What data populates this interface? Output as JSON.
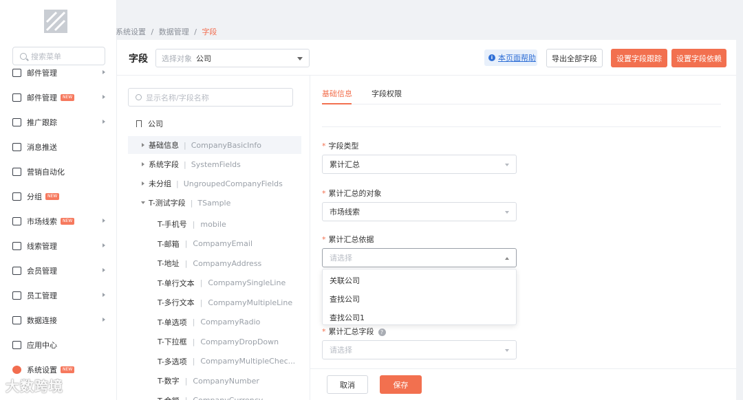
{
  "breadcrumb": [
    "系统设置",
    "/",
    "数据管理",
    "/",
    "字段"
  ],
  "sidebar": {
    "search_placeholder": "搜索菜单",
    "items": [
      {
        "label": "邮件管理",
        "icon": "mail-icon",
        "new": false,
        "arrow": true
      },
      {
        "label": "邮件管理",
        "icon": "mail-icon",
        "new": true,
        "arrow": true
      },
      {
        "label": "推广跟踪",
        "icon": "target-icon",
        "new": false,
        "arrow": true
      },
      {
        "label": "消息推送",
        "icon": "send-icon",
        "new": false,
        "arrow": false
      },
      {
        "label": "营销自动化",
        "icon": "automation-icon",
        "new": false,
        "arrow": false
      },
      {
        "label": "分组",
        "icon": "group-icon",
        "new": true,
        "arrow": false
      },
      {
        "label": "市场线索",
        "icon": "leads-icon",
        "new": true,
        "arrow": true
      },
      {
        "label": "线索管理",
        "icon": "clue-icon",
        "new": false,
        "arrow": true
      },
      {
        "label": "会员管理",
        "icon": "diamond-icon",
        "new": false,
        "arrow": true
      },
      {
        "label": "员工管理",
        "icon": "staff-icon",
        "new": false,
        "arrow": true
      },
      {
        "label": "数据连接",
        "icon": "data-link-icon",
        "new": false,
        "arrow": true
      },
      {
        "label": "应用中心",
        "icon": "app-center-icon",
        "new": false,
        "arrow": false
      },
      {
        "label": "系统设置",
        "icon": "settings-icon",
        "new": true,
        "arrow": false
      }
    ],
    "new_badge": "NEW"
  },
  "header": {
    "title": "字段",
    "object_placeholder": "选择对象",
    "object_value": "公司",
    "help_label": "本页面帮助",
    "help_icon": "i",
    "export_label": "导出全部字段",
    "track_label": "设置字段跟踪",
    "depend_label": "设置字段依赖"
  },
  "tree": {
    "search_placeholder": "显示名称/字段名称",
    "root": "公司",
    "nodes": [
      {
        "cn": "基础信息",
        "en": "CompanyBasicInfo",
        "expanded": false,
        "selected": true
      },
      {
        "cn": "系统字段",
        "en": "SystemFields",
        "expanded": false,
        "selected": false
      },
      {
        "cn": "未分组",
        "en": "UngroupedCompanyFields",
        "expanded": false,
        "selected": false
      },
      {
        "cn": "T-测试字段",
        "en": "TSample",
        "expanded": true,
        "selected": false
      }
    ],
    "leaves": [
      {
        "cn": "T-手机号",
        "en": "mobile"
      },
      {
        "cn": "T-邮箱",
        "en": "CompamyEmail"
      },
      {
        "cn": "T-地址",
        "en": "CompamyAddress"
      },
      {
        "cn": "T-单行文本",
        "en": "CompamySingleLine"
      },
      {
        "cn": "T-多行文本",
        "en": "CompamyMultipleLine"
      },
      {
        "cn": "T-单选项",
        "en": "CompamyRadio"
      },
      {
        "cn": "T-下拉框",
        "en": "CompamyDropDown"
      },
      {
        "cn": "T-多选项",
        "en": "CompamyMultipleChec..."
      },
      {
        "cn": "T-数字",
        "en": "CompanyNumber"
      },
      {
        "cn": "T-金额",
        "en": "CompanyCurrency"
      }
    ],
    "separator": "|"
  },
  "tabs": [
    {
      "label": "基础信息",
      "active": true
    },
    {
      "label": "字段权限",
      "active": false
    }
  ],
  "form": {
    "required_mark": "*",
    "field_type_label": "字段类型",
    "field_type_value": "累计汇总",
    "rollup_object_label": "累计汇总的对象",
    "rollup_object_value": "市场线索",
    "rollup_basis_label": "累计汇总依据",
    "rollup_basis_placeholder": "请选择",
    "rollup_field_label": "累计汇总字段",
    "rollup_field_placeholder": "请选择",
    "help_mark": "?"
  },
  "dropdown_options": [
    "关联公司",
    "查找公司",
    "查找公司1"
  ],
  "footer": {
    "cancel_label": "取消",
    "save_label": "保存"
  },
  "watermark": "大数跨境",
  "colors": {
    "accent": "#f2704f",
    "link": "#2f6fd6"
  }
}
